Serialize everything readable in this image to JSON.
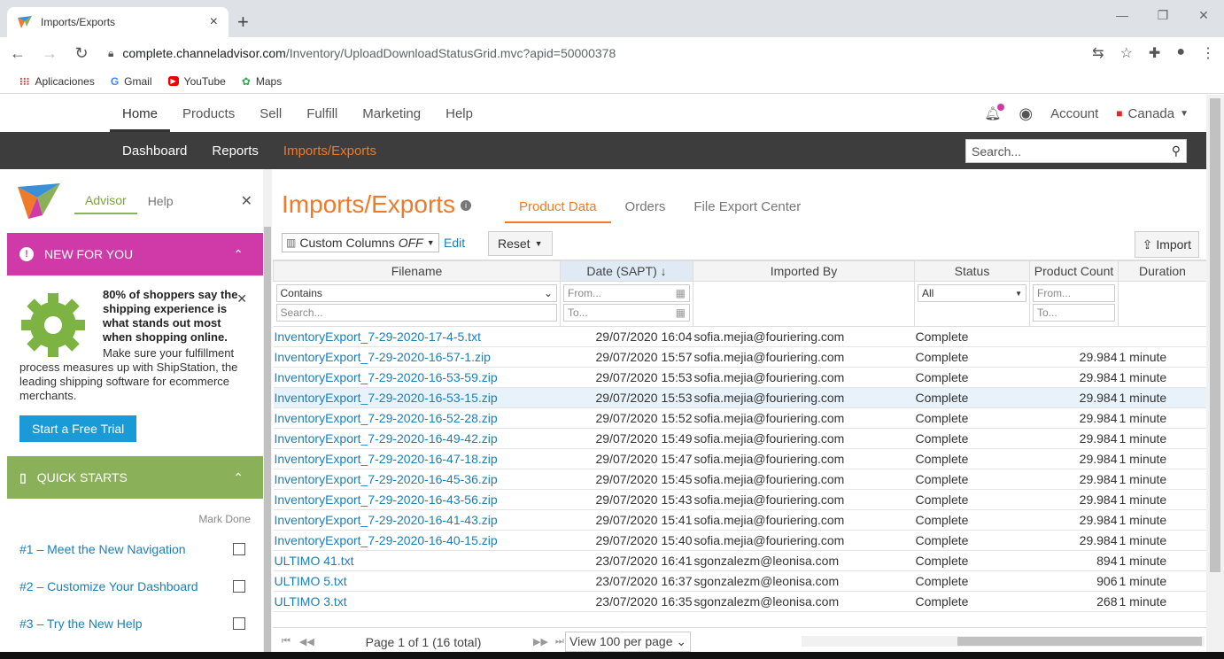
{
  "browser": {
    "tab_title": "Imports/Exports",
    "url_host": "complete.channeladvisor.com",
    "url_path": "/Inventory/UploadDownloadStatusGrid.mvc?apid=50000378",
    "bookmarks": [
      "Aplicaciones",
      "Gmail",
      "YouTube",
      "Maps"
    ]
  },
  "topnav": {
    "items": [
      "Home",
      "Products",
      "Sell",
      "Fulfill",
      "Marketing",
      "Help"
    ],
    "account": "Account",
    "country": "Canada"
  },
  "subnav": {
    "items": [
      "Dashboard",
      "Reports",
      "Imports/Exports"
    ],
    "search_placeholder": "Search..."
  },
  "sidebar": {
    "tabs": [
      "Advisor",
      "Help"
    ],
    "new_for_you": {
      "title": "NEW FOR YOU",
      "headline": "80% of shoppers say the shipping experience is what stands out most when shopping online.",
      "body": "Make sure your fulfillment process measures up with ShipStation, the leading shipping software for ecommerce merchants.",
      "cta": "Start a Free Trial"
    },
    "quick_starts": {
      "title": "QUICK STARTS",
      "mark_done": "Mark Done",
      "items": [
        "#1 – Meet the New Navigation",
        "#2 – Customize Your Dashboard",
        "#3 – Try the New Help"
      ]
    }
  },
  "main": {
    "title": "Imports/Exports",
    "tabs": [
      "Product Data",
      "Orders",
      "File Export Center"
    ],
    "toolbar": {
      "custom_columns": "Custom Columns",
      "custom_columns_state": "OFF",
      "edit": "Edit",
      "reset": "Reset",
      "import": "Import"
    },
    "columns": [
      "Filename",
      "Date (SAPT)",
      "Imported By",
      "Status",
      "Product Count",
      "Duration"
    ],
    "filters": {
      "filename_mode": "Contains",
      "filename_placeholder": "Search...",
      "date_from": "From...",
      "date_to": "To...",
      "status": "All",
      "count_from": "From...",
      "count_to": "To..."
    },
    "rows": [
      {
        "file": "InventoryExport_7-29-2020-17-4-5.txt",
        "date": "29/07/2020 16:04",
        "by": "sofia.mejia@fouriering.com",
        "status": "Complete",
        "count": "",
        "duration": ""
      },
      {
        "file": "InventoryExport_7-29-2020-16-57-1.zip",
        "date": "29/07/2020 15:57",
        "by": "sofia.mejia@fouriering.com",
        "status": "Complete",
        "count": "29.984",
        "duration": "1 minute"
      },
      {
        "file": "InventoryExport_7-29-2020-16-53-59.zip",
        "date": "29/07/2020 15:53",
        "by": "sofia.mejia@fouriering.com",
        "status": "Complete",
        "count": "29.984",
        "duration": "1 minute"
      },
      {
        "file": "InventoryExport_7-29-2020-16-53-15.zip",
        "date": "29/07/2020 15:53",
        "by": "sofia.mejia@fouriering.com",
        "status": "Complete",
        "count": "29.984",
        "duration": "1 minute"
      },
      {
        "file": "InventoryExport_7-29-2020-16-52-28.zip",
        "date": "29/07/2020 15:52",
        "by": "sofia.mejia@fouriering.com",
        "status": "Complete",
        "count": "29.984",
        "duration": "1 minute"
      },
      {
        "file": "InventoryExport_7-29-2020-16-49-42.zip",
        "date": "29/07/2020 15:49",
        "by": "sofia.mejia@fouriering.com",
        "status": "Complete",
        "count": "29.984",
        "duration": "1 minute"
      },
      {
        "file": "InventoryExport_7-29-2020-16-47-18.zip",
        "date": "29/07/2020 15:47",
        "by": "sofia.mejia@fouriering.com",
        "status": "Complete",
        "count": "29.984",
        "duration": "1 minute"
      },
      {
        "file": "InventoryExport_7-29-2020-16-45-36.zip",
        "date": "29/07/2020 15:45",
        "by": "sofia.mejia@fouriering.com",
        "status": "Complete",
        "count": "29.984",
        "duration": "1 minute"
      },
      {
        "file": "InventoryExport_7-29-2020-16-43-56.zip",
        "date": "29/07/2020 15:43",
        "by": "sofia.mejia@fouriering.com",
        "status": "Complete",
        "count": "29.984",
        "duration": "1 minute"
      },
      {
        "file": "InventoryExport_7-29-2020-16-41-43.zip",
        "date": "29/07/2020 15:41",
        "by": "sofia.mejia@fouriering.com",
        "status": "Complete",
        "count": "29.984",
        "duration": "1 minute"
      },
      {
        "file": "InventoryExport_7-29-2020-16-40-15.zip",
        "date": "29/07/2020 15:40",
        "by": "sofia.mejia@fouriering.com",
        "status": "Complete",
        "count": "29.984",
        "duration": "1 minute"
      },
      {
        "file": "ULTIMO 41.txt",
        "date": "23/07/2020 16:41",
        "by": "sgonzalezm@leonisa.com",
        "status": "Complete",
        "count": "894",
        "duration": "1 minute"
      },
      {
        "file": "ULTIMO 5.txt",
        "date": "23/07/2020 16:37",
        "by": "sgonzalezm@leonisa.com",
        "status": "Complete",
        "count": "906",
        "duration": "1 minute"
      },
      {
        "file": "ULTIMO 3.txt",
        "date": "23/07/2020 16:35",
        "by": "sgonzalezm@leonisa.com",
        "status": "Complete",
        "count": "268",
        "duration": "1 minute"
      }
    ],
    "pager": {
      "page_info": "Page 1 of 1 (16 total)",
      "per_page": "View 100 per page"
    }
  },
  "colors": {
    "accent": "#ef7a2a",
    "link": "#1a7fb8",
    "pink": "#d03aa8",
    "green": "#8ab05a"
  }
}
